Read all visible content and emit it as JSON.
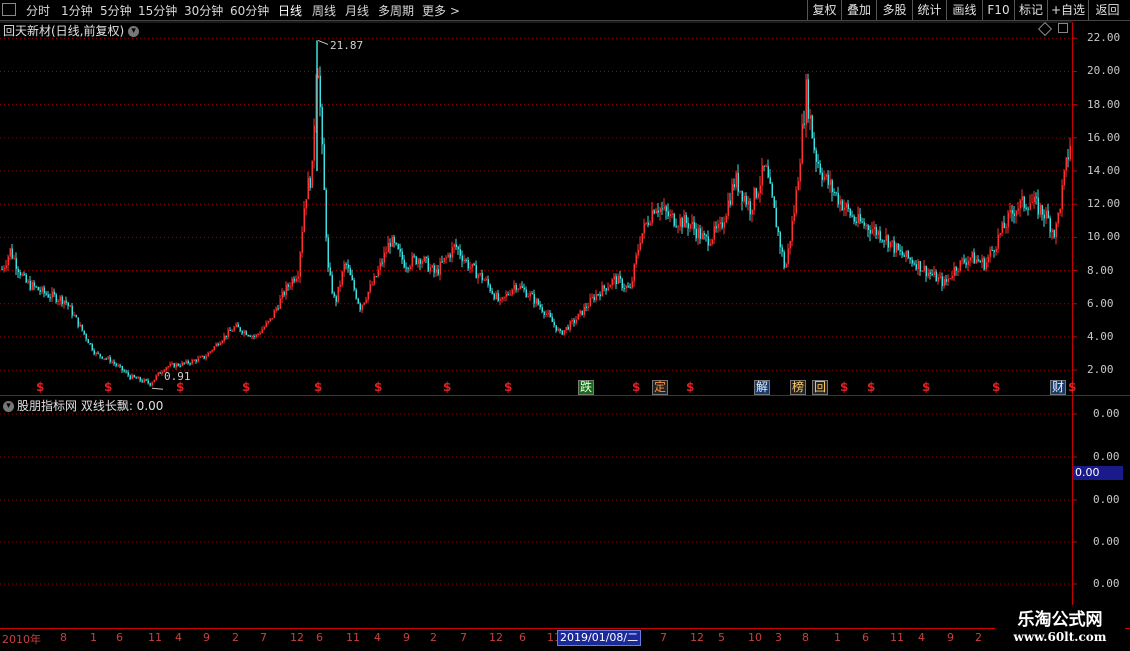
{
  "toolbar": {
    "periods": [
      "分时",
      "1分钟",
      "5分钟",
      "15分钟",
      "30分钟",
      "60分钟",
      "日线",
      "周线",
      "月线",
      "多周期",
      "更多 >"
    ],
    "active_period": "日线",
    "right_buttons": [
      "复权",
      "叠加",
      "多股",
      "统计",
      "画线",
      "F10",
      "标记",
      "+自选",
      "返回"
    ]
  },
  "main_panel": {
    "title": "回天新材(日线,前复权)",
    "high_label": "21.87",
    "low_label": "0.91",
    "event_marks": [
      "$",
      "$",
      "$",
      "$",
      "$",
      "$",
      "$",
      "$",
      "跌",
      "$",
      "定",
      "$",
      "解",
      "榜",
      "回",
      "$",
      "$",
      "$",
      "$",
      "财",
      "$"
    ]
  },
  "sub_panel": {
    "title": "股朋指标网 双线长飘",
    "value_label": ": 0.00",
    "cursor_value": "0.00"
  },
  "date_axis": {
    "labels": [
      "2010年",
      "8",
      "1",
      "6",
      "11",
      "4",
      "9",
      "2",
      "7",
      "12",
      "6",
      "11",
      "4",
      "9",
      "2",
      "7",
      "12",
      "6",
      "11",
      "7",
      "12",
      "5",
      "10",
      "3",
      "8",
      "1",
      "6",
      "11",
      "4",
      "9",
      "2"
    ],
    "cursor_date": "2019/01/08/二"
  },
  "watermark": {
    "title": "乐淘公式网",
    "url": "www.60lt.com"
  },
  "colors": {
    "up": "#ff3030",
    "down": "#40e0e0",
    "grid": "#a00000",
    "axis_line": "#c00000"
  },
  "chart_data": {
    "type": "candlestick",
    "price_axis": {
      "ylim": [
        0.5,
        22.8
      ],
      "ticks": [
        "22.00",
        "20.00",
        "18.00",
        "16.00",
        "14.00",
        "12.00",
        "10.00",
        "8.00",
        "6.00",
        "4.00",
        "2.00"
      ]
    },
    "indicator_axis": {
      "ticks": [
        "0.00",
        "0.00",
        "0.00",
        "0.00",
        "0.00"
      ]
    },
    "high": 21.87,
    "low": 0.91,
    "close_path": [
      [
        0,
        7.8
      ],
      [
        10,
        9.2
      ],
      [
        25,
        7.3
      ],
      [
        45,
        6.6
      ],
      [
        65,
        6.2
      ],
      [
        80,
        4.6
      ],
      [
        95,
        3.0
      ],
      [
        110,
        2.6
      ],
      [
        130,
        1.6
      ],
      [
        150,
        1.2
      ],
      [
        165,
        2.2
      ],
      [
        185,
        2.4
      ],
      [
        205,
        2.8
      ],
      [
        220,
        3.8
      ],
      [
        235,
        4.6
      ],
      [
        255,
        4.0
      ],
      [
        270,
        5.0
      ],
      [
        285,
        6.8
      ],
      [
        298,
        8.0
      ],
      [
        305,
        12.5
      ],
      [
        312,
        14.0
      ],
      [
        317,
        21.87
      ],
      [
        322,
        15.0
      ],
      [
        328,
        8.0
      ],
      [
        335,
        6.0
      ],
      [
        345,
        8.5
      ],
      [
        360,
        5.8
      ],
      [
        375,
        7.5
      ],
      [
        390,
        9.8
      ],
      [
        405,
        8.4
      ],
      [
        420,
        8.8
      ],
      [
        435,
        7.8
      ],
      [
        455,
        9.5
      ],
      [
        470,
        8.2
      ],
      [
        485,
        7.4
      ],
      [
        500,
        6.0
      ],
      [
        515,
        7.2
      ],
      [
        530,
        6.5
      ],
      [
        545,
        5.5
      ],
      [
        560,
        4.2
      ],
      [
        575,
        5.0
      ],
      [
        595,
        6.5
      ],
      [
        615,
        7.5
      ],
      [
        630,
        6.8
      ],
      [
        640,
        10.0
      ],
      [
        655,
        12.0
      ],
      [
        670,
        11.2
      ],
      [
        690,
        10.8
      ],
      [
        705,
        9.8
      ],
      [
        720,
        10.5
      ],
      [
        735,
        13.5
      ],
      [
        750,
        11.8
      ],
      [
        765,
        14.2
      ],
      [
        775,
        11.2
      ],
      [
        785,
        8.0
      ],
      [
        795,
        12.0
      ],
      [
        806,
        18.8
      ],
      [
        815,
        15.0
      ],
      [
        825,
        13.5
      ],
      [
        840,
        12.2
      ],
      [
        855,
        11.0
      ],
      [
        870,
        10.6
      ],
      [
        885,
        10.0
      ],
      [
        900,
        9.0
      ],
      [
        915,
        8.5
      ],
      [
        930,
        7.8
      ],
      [
        945,
        7.2
      ],
      [
        955,
        8.2
      ],
      [
        970,
        8.8
      ],
      [
        985,
        8.4
      ],
      [
        1000,
        10.2
      ],
      [
        1015,
        11.8
      ],
      [
        1030,
        12.2
      ],
      [
        1045,
        11.4
      ],
      [
        1055,
        10.2
      ],
      [
        1062,
        12.8
      ],
      [
        1068,
        15.0
      ],
      [
        1072,
        16.4
      ]
    ]
  }
}
